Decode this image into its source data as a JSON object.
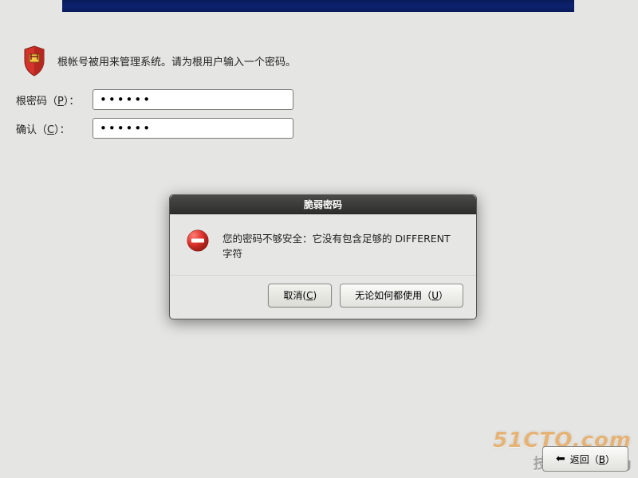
{
  "header_text": "根帐号被用来管理系统。请为根用户输入一个密码。",
  "fields": {
    "root_password": {
      "label_pre": "根密码（",
      "key": "P",
      "label_post": "）：",
      "value": "••••••"
    },
    "confirm": {
      "label_pre": "确认（",
      "key": "C",
      "label_post": "）：",
      "value": "••••••"
    }
  },
  "dialog": {
    "title": "脆弱密码",
    "message": "您的密码不够安全：它没有包含足够的 DIFFERENT 字符",
    "cancel_pre": "取消(",
    "cancel_key": "C",
    "cancel_post": ")",
    "use_anyway_pre": "无论如何都使用（",
    "use_anyway_key": "U",
    "use_anyway_post": "）"
  },
  "footer": {
    "back_pre": "返回（",
    "back_key": "B",
    "back_post": "）"
  },
  "watermark": {
    "line1": "51CTO.com",
    "line2": "技术博客  Blog"
  }
}
